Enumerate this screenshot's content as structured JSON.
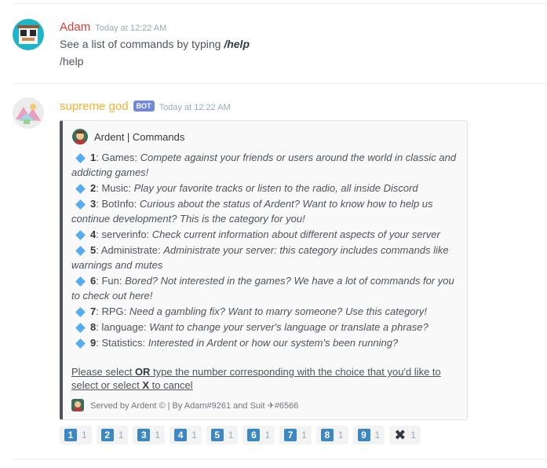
{
  "messages": [
    {
      "username": "Adam",
      "username_color": "#e03a36",
      "timestamp": "Today at 12:22 AM",
      "line1_prefix": "See a list of commands by typing ",
      "line1_command": "/help",
      "line2": "/help"
    },
    {
      "username": "supreme god",
      "username_color": "#f0b232",
      "bot_tag": "BOT",
      "timestamp": "Today at 12:22 AM"
    }
  ],
  "embed": {
    "author_name": "Ardent | Commands",
    "border_color": "#4f545c",
    "items": [
      {
        "num": "1",
        "name": "Games",
        "desc": "Compete against your friends or users around the world in classic and addicting games!"
      },
      {
        "num": "2",
        "name": "Music",
        "desc": "Play your favorite tracks or listen to the radio, all inside Discord"
      },
      {
        "num": "3",
        "name": "BotInfo",
        "desc": "Curious about the status of Ardent? Want to know how to help us continue development? This is the category for you!"
      },
      {
        "num": "4",
        "name": "serverinfo",
        "desc": "Check current information about different aspects of your server"
      },
      {
        "num": "5",
        "name": "Administrate",
        "desc": "Administrate your server: this category includes commands like warnings and mutes"
      },
      {
        "num": "6",
        "name": "Fun",
        "desc": "Bored? Not interested in the games? We have a lot of commands for you to check out here!"
      },
      {
        "num": "7",
        "name": "RPG",
        "desc": "Need a gambling fix? Want to marry someone? Use this category!"
      },
      {
        "num": "8",
        "name": "language",
        "desc": "Want to change your server's language or translate a phrase?"
      },
      {
        "num": "9",
        "name": "Statistics",
        "desc": "Interested in Ardent or how our system's been running?"
      }
    ],
    "select_note": {
      "part1": "Please select ",
      "or": "OR",
      "part2": " type the number corresponding with the choice that you'd like to select or select ",
      "x": "X",
      "part3": " to cancel"
    },
    "footer": "Served by Ardent © | By Adam#9261 and Suit ✈#6566"
  },
  "reactions": [
    {
      "emoji": "1",
      "icon": "keycap-1-icon",
      "count": "1"
    },
    {
      "emoji": "2",
      "icon": "keycap-2-icon",
      "count": "1"
    },
    {
      "emoji": "3",
      "icon": "keycap-3-icon",
      "count": "1"
    },
    {
      "emoji": "4",
      "icon": "keycap-4-icon",
      "count": "1"
    },
    {
      "emoji": "5",
      "icon": "keycap-5-icon",
      "count": "1"
    },
    {
      "emoji": "6",
      "icon": "keycap-6-icon",
      "count": "1"
    },
    {
      "emoji": "7",
      "icon": "keycap-7-icon",
      "count": "1"
    },
    {
      "emoji": "8",
      "icon": "keycap-8-icon",
      "count": "1"
    },
    {
      "emoji": "9",
      "icon": "keycap-9-icon",
      "count": "1"
    },
    {
      "emoji": "✖",
      "icon": "x-mark-icon",
      "count": "1"
    }
  ]
}
